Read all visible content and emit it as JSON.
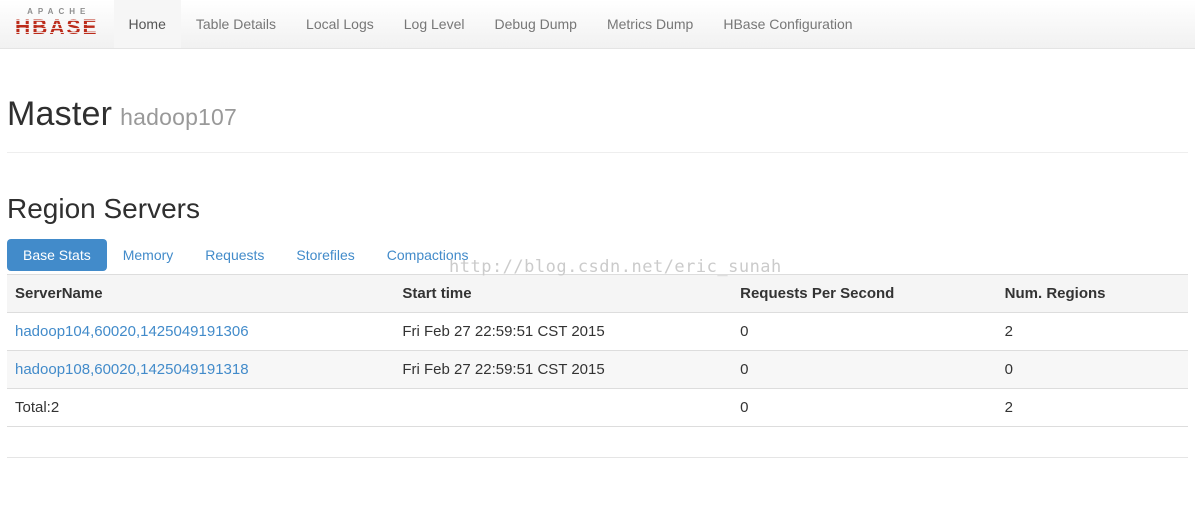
{
  "navbar": {
    "logo": {
      "top": "APACHE",
      "bottom": "HBASE"
    },
    "items": [
      {
        "label": "Home",
        "active": true
      },
      {
        "label": "Table Details",
        "active": false
      },
      {
        "label": "Local Logs",
        "active": false
      },
      {
        "label": "Log Level",
        "active": false
      },
      {
        "label": "Debug Dump",
        "active": false
      },
      {
        "label": "Metrics Dump",
        "active": false
      },
      {
        "label": "HBase Configuration",
        "active": false
      }
    ]
  },
  "master": {
    "title": "Master",
    "subtitle": "hadoop107"
  },
  "region_servers": {
    "title": "Region Servers",
    "tabs": [
      {
        "label": "Base Stats",
        "active": true
      },
      {
        "label": "Memory",
        "active": false
      },
      {
        "label": "Requests",
        "active": false
      },
      {
        "label": "Storefiles",
        "active": false
      },
      {
        "label": "Compactions",
        "active": false
      }
    ],
    "table": {
      "columns": [
        "ServerName",
        "Start time",
        "Requests Per Second",
        "Num. Regions"
      ],
      "rows": [
        {
          "server": "hadoop104,60020,1425049191306",
          "start": "Fri Feb 27 22:59:51 CST 2015",
          "requests_per_second": "0",
          "num_regions": "2"
        },
        {
          "server": "hadoop108,60020,1425049191318",
          "start": "Fri Feb 27 22:59:51 CST 2015",
          "requests_per_second": "0",
          "num_regions": "0"
        }
      ],
      "total": {
        "label": "Total:2",
        "start": "",
        "requests_per_second": "0",
        "num_regions": "2"
      }
    }
  },
  "watermark": "http://blog.csdn.net/eric_sunah",
  "colors": {
    "accent_blue": "#428bca",
    "logo_red": "#bb2b1a",
    "navbar_bg": "#f4f4f4",
    "table_header_bg": "#f5f5f5",
    "stripe_bg": "#f7f7f7",
    "border": "#dddddd"
  }
}
